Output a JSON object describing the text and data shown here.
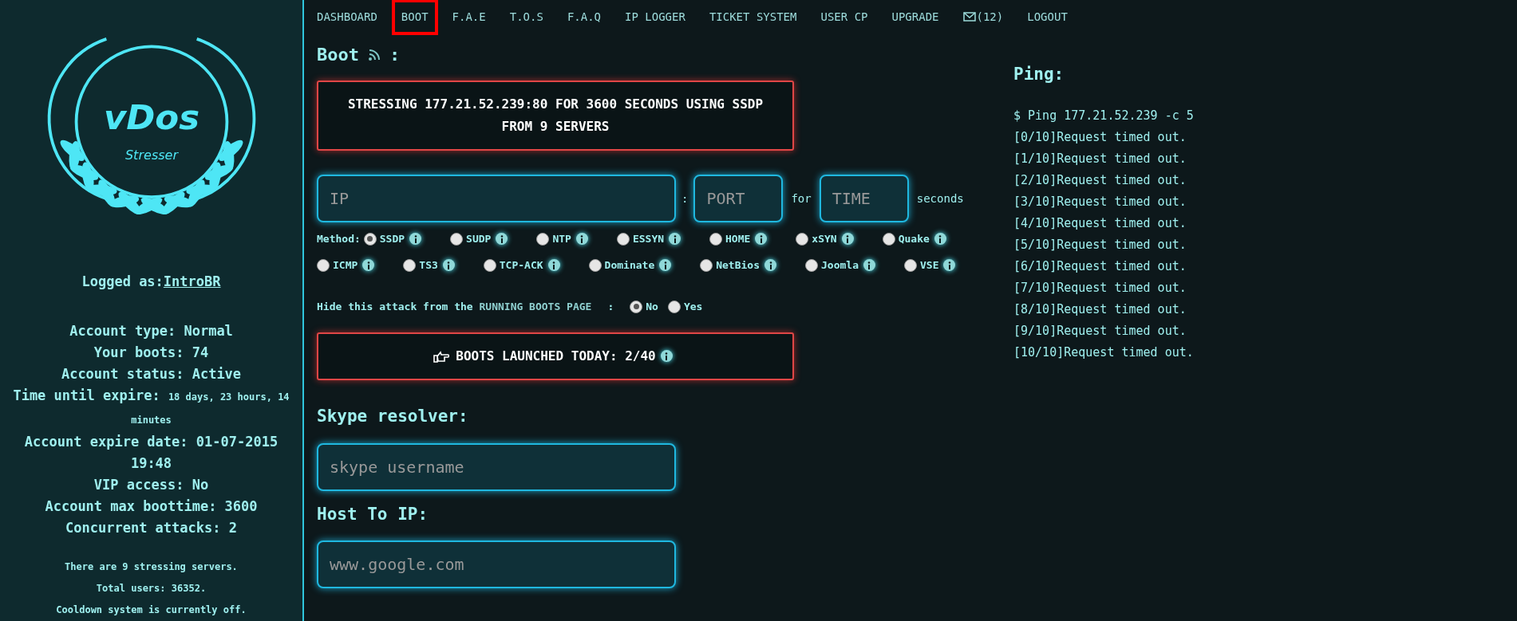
{
  "sidebar": {
    "logo": {
      "title": "vDos",
      "subtitle": "Stresser"
    },
    "logged_as": {
      "label": "Logged as:",
      "user": "IntroBR"
    },
    "stats": [
      {
        "label": "Account type:",
        "value": "Normal"
      },
      {
        "label": "Your boots:",
        "value": "74"
      },
      {
        "label": "Account status:",
        "value": "Active"
      },
      {
        "label": "Time until expire:",
        "value": "18 days, 23 hours, 14 minutes",
        "kind": "small"
      },
      {
        "label": "Account expire date:",
        "value": "01-07-2015 19:48"
      },
      {
        "label": "VIP access:",
        "value": "No"
      },
      {
        "label": "Account max boottime:",
        "value": "3600"
      },
      {
        "label": "Concurrent attacks:",
        "value": "2"
      }
    ],
    "notes": [
      "There are 9 stressing servers.",
      "Total users: 36352.",
      "Cooldown system is currently off."
    ]
  },
  "nav": [
    {
      "label": "DASHBOARD",
      "selected": false
    },
    {
      "label": "BOOT",
      "selected": true
    },
    {
      "label": "F.A.E",
      "selected": false
    },
    {
      "label": "T.O.S",
      "selected": false
    },
    {
      "label": "F.A.Q",
      "selected": false
    },
    {
      "label": "IP LOGGER",
      "selected": false
    },
    {
      "label": "TICKET SYSTEM",
      "selected": false
    },
    {
      "label": "USER CP",
      "selected": false
    },
    {
      "label": "UPGRADE",
      "selected": false
    },
    {
      "label": "(12)",
      "selected": false,
      "kind": "mail"
    },
    {
      "label": "LOGOUT",
      "selected": false
    }
  ],
  "boot": {
    "title": "Boot",
    "colon": ":",
    "status": "STRESSING 177.21.52.239:80 FOR 3600 SECONDS USING SSDP FROM 9 SERVERS",
    "ip": {
      "placeholder": "IP"
    },
    "sep": ":",
    "port": {
      "placeholder": "PORT"
    },
    "for": "for",
    "time": {
      "placeholder": "TIME"
    },
    "seconds": "seconds",
    "method_label": "Method:",
    "methods": [
      {
        "label": "SSDP",
        "selected": true
      },
      {
        "label": "SUDP",
        "selected": false
      },
      {
        "label": "NTP",
        "selected": false
      },
      {
        "label": "ESSYN",
        "selected": false
      },
      {
        "label": "HOME",
        "selected": false
      },
      {
        "label": "xSYN",
        "selected": false
      },
      {
        "label": "Quake",
        "selected": false
      },
      {
        "label": "ICMP",
        "selected": false
      },
      {
        "label": "TS3",
        "selected": false
      },
      {
        "label": "TCP-ACK",
        "selected": false
      },
      {
        "label": "Dominate",
        "selected": false
      },
      {
        "label": "NetBios",
        "selected": false
      },
      {
        "label": "Joomla",
        "selected": false
      },
      {
        "label": "VSE",
        "selected": false
      }
    ],
    "hide": {
      "label": "Hide this attack from the",
      "link": "RUNNING BOOTS PAGE",
      "colon": ":",
      "options": [
        {
          "label": "No",
          "selected": true
        },
        {
          "label": "Yes",
          "selected": false
        }
      ]
    },
    "launched": "BOOTS LAUNCHED TODAY: 2/40"
  },
  "skype": {
    "title": "Skype resolver:",
    "placeholder": "skype username"
  },
  "host": {
    "title": "Host To IP:",
    "placeholder": "www.google.com"
  },
  "ping": {
    "title": "Ping:",
    "command": "$ Ping 177.21.52.239 -c 5",
    "lines": [
      "[0/10]Request timed out.",
      "[1/10]Request timed out.",
      "[2/10]Request timed out.",
      "[3/10]Request timed out.",
      "[4/10]Request timed out.",
      "[5/10]Request timed out.",
      "[6/10]Request timed out.",
      "[7/10]Request timed out.",
      "[8/10]Request timed out.",
      "[9/10]Request timed out.",
      "[10/10]Request timed out."
    ]
  }
}
